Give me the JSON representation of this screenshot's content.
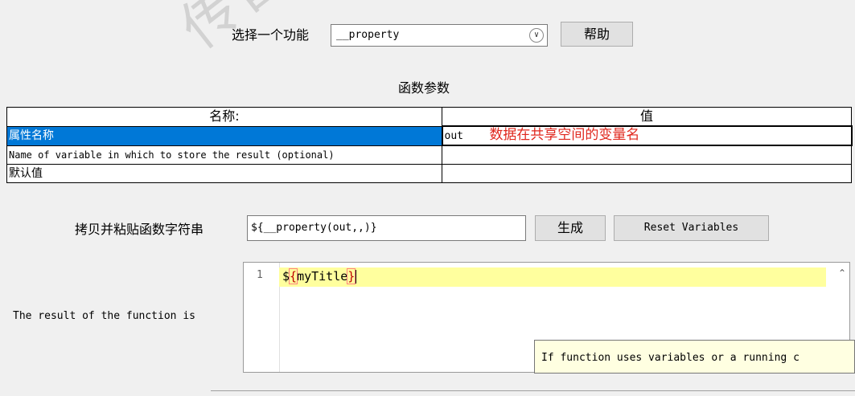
{
  "function_select": {
    "label": "选择一个功能",
    "value": "__property",
    "help_label": "帮助"
  },
  "params": {
    "title": "函数参数",
    "columns": [
      "名称:",
      "值"
    ],
    "rows": [
      {
        "name": "属性名称",
        "value": "out",
        "note": "数据在共享空间的变量名"
      },
      {
        "name": "Name of variable in which to store the result (optional)",
        "value": ""
      },
      {
        "name": "默认值",
        "value": ""
      }
    ]
  },
  "copy": {
    "label": "拷贝并粘贴函数字符串",
    "value": "${__property(out,,)}",
    "generate_label": "生成",
    "reset_label": "Reset Variables"
  },
  "result": {
    "label": "The result of the function is",
    "line_number": "1",
    "code_prefix": "$",
    "code_open": "{",
    "code_name": "myTitle",
    "code_close": "}"
  },
  "tooltip": {
    "text": "If function uses variables or a running c"
  },
  "watermark": "传智播客 www.itcast"
}
